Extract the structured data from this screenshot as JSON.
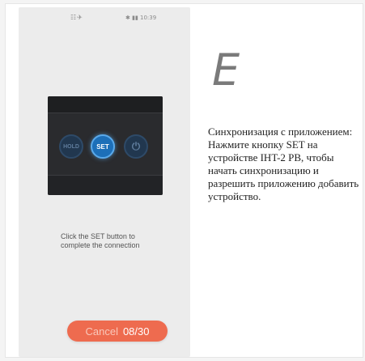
{
  "status_bar": {
    "left_icons": "☷✈",
    "right": "✱ ▮▮ 10:39"
  },
  "device": {
    "hold_label": "HOLD",
    "set_label": "SET",
    "power_icon": "power-icon",
    "power_glyph": "⏻"
  },
  "instruction": "Click the SET button to complete the connection",
  "cancel": {
    "label": "Cancel",
    "count": "08/30"
  },
  "step_letter": "E",
  "description": "Синхронизация с приложением: Нажмите кнопку SET на устройстве IHT-2 PB, чтобы начать синхронизацию и разрешить приложению добавить устройство.",
  "colors": {
    "accent": "#ee6b4f",
    "set_button": "#1d6fb8",
    "device_body": "#2a2b2e"
  }
}
